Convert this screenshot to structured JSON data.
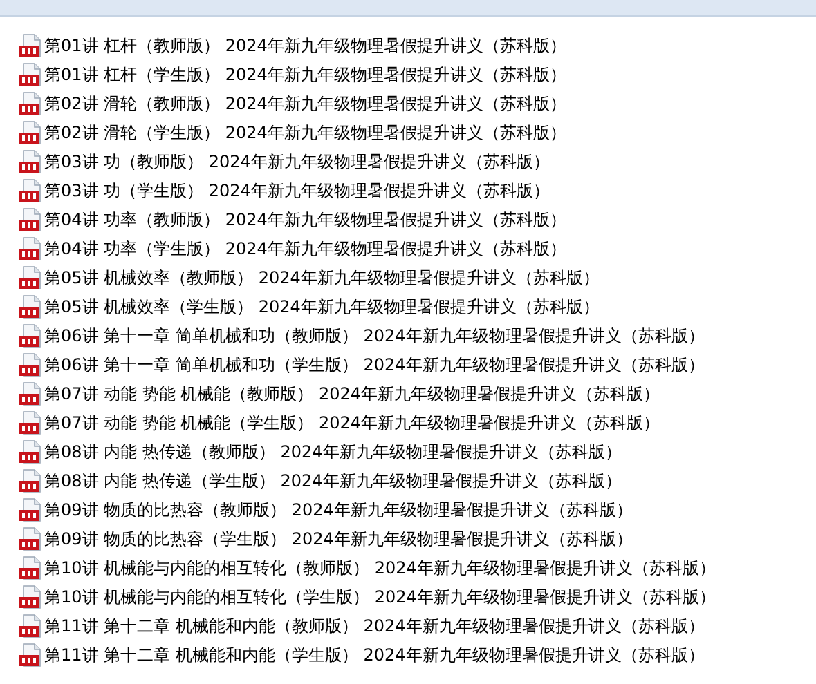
{
  "files": [
    {
      "name": "第01讲 杠杆（教师版） 2024年新九年级物理暑假提升讲义（苏科版）"
    },
    {
      "name": "第01讲 杠杆（学生版） 2024年新九年级物理暑假提升讲义（苏科版）"
    },
    {
      "name": "第02讲 滑轮（教师版） 2024年新九年级物理暑假提升讲义（苏科版）"
    },
    {
      "name": "第02讲 滑轮（学生版） 2024年新九年级物理暑假提升讲义（苏科版）"
    },
    {
      "name": "第03讲 功（教师版） 2024年新九年级物理暑假提升讲义（苏科版）"
    },
    {
      "name": "第03讲 功（学生版） 2024年新九年级物理暑假提升讲义（苏科版）"
    },
    {
      "name": "第04讲 功率（教师版） 2024年新九年级物理暑假提升讲义（苏科版）"
    },
    {
      "name": "第04讲 功率（学生版） 2024年新九年级物理暑假提升讲义（苏科版）"
    },
    {
      "name": "第05讲 机械效率（教师版） 2024年新九年级物理暑假提升讲义（苏科版）"
    },
    {
      "name": "第05讲 机械效率（学生版） 2024年新九年级物理暑假提升讲义（苏科版）"
    },
    {
      "name": "第06讲 第十一章 简单机械和功（教师版） 2024年新九年级物理暑假提升讲义（苏科版）"
    },
    {
      "name": "第06讲 第十一章 简单机械和功（学生版） 2024年新九年级物理暑假提升讲义（苏科版）"
    },
    {
      "name": "第07讲 动能 势能 机械能（教师版） 2024年新九年级物理暑假提升讲义（苏科版）"
    },
    {
      "name": "第07讲 动能 势能 机械能（学生版） 2024年新九年级物理暑假提升讲义（苏科版）"
    },
    {
      "name": "第08讲 内能 热传递（教师版） 2024年新九年级物理暑假提升讲义（苏科版）"
    },
    {
      "name": "第08讲 内能 热传递（学生版） 2024年新九年级物理暑假提升讲义（苏科版）"
    },
    {
      "name": "第09讲 物质的比热容（教师版） 2024年新九年级物理暑假提升讲义（苏科版）"
    },
    {
      "name": "第09讲 物质的比热容（学生版） 2024年新九年级物理暑假提升讲义（苏科版）"
    },
    {
      "name": "第10讲 机械能与内能的相互转化（教师版） 2024年新九年级物理暑假提升讲义（苏科版）"
    },
    {
      "name": "第10讲 机械能与内能的相互转化（学生版） 2024年新九年级物理暑假提升讲义（苏科版）"
    },
    {
      "name": "第11讲 第十二章 机械能和内能（教师版） 2024年新九年级物理暑假提升讲义（苏科版）"
    },
    {
      "name": "第11讲 第十二章 机械能和内能（学生版） 2024年新九年级物理暑假提升讲义（苏科版）"
    }
  ]
}
